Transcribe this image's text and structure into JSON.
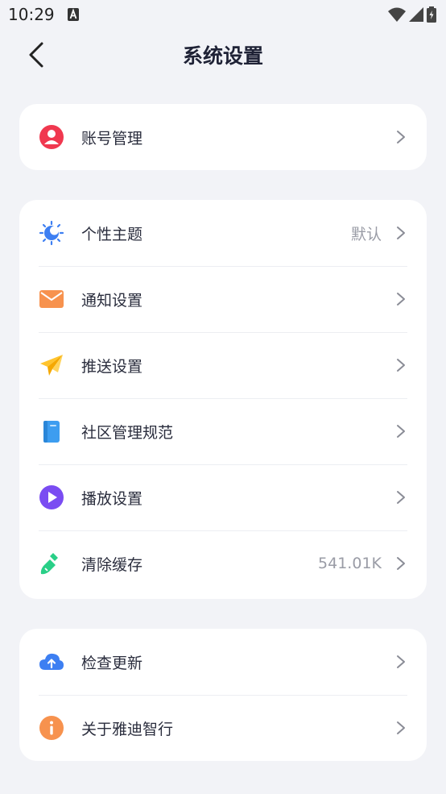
{
  "status_bar": {
    "time": "10:29"
  },
  "header": {
    "title": "系统设置"
  },
  "cards": [
    {
      "rows": [
        {
          "label": "账号管理",
          "value": ""
        }
      ]
    },
    {
      "rows": [
        {
          "label": "个性主题",
          "value": "默认"
        },
        {
          "label": "通知设置",
          "value": ""
        },
        {
          "label": "推送设置",
          "value": ""
        },
        {
          "label": "社区管理规范",
          "value": ""
        },
        {
          "label": "播放设置",
          "value": ""
        },
        {
          "label": "清除缓存",
          "value": "541.01K"
        }
      ]
    },
    {
      "rows": [
        {
          "label": "检查更新",
          "value": ""
        },
        {
          "label": "关于雅迪智行",
          "value": ""
        }
      ]
    }
  ],
  "colors": {
    "account": "#f0384f",
    "theme": "#3d7ff2",
    "notify": "#f7924e",
    "push": "#ffc42e",
    "community": "#3d9df0",
    "play": "#7a4cf2",
    "cache": "#29cf87",
    "update": "#3d7ff2",
    "about": "#f7924e"
  }
}
